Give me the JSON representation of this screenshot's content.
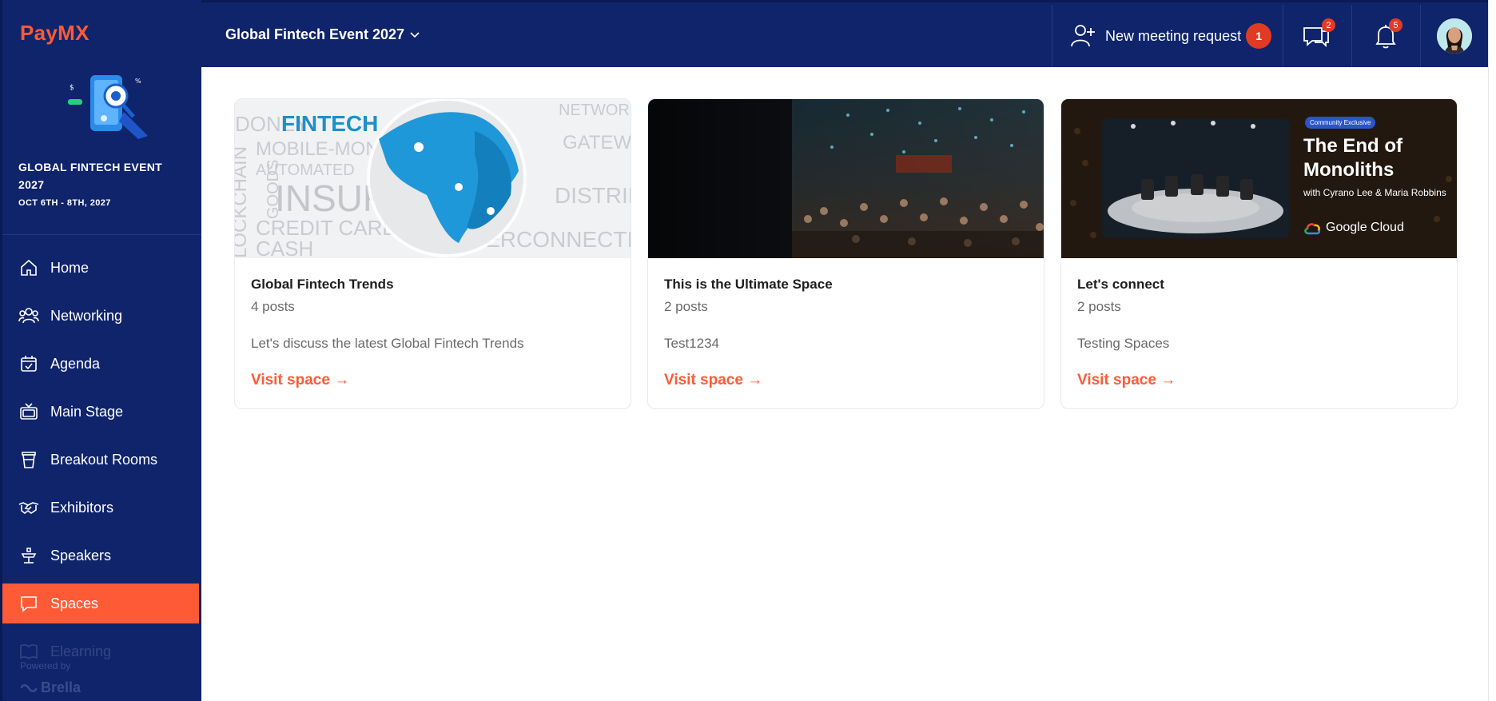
{
  "app": {
    "brand": "PayMX"
  },
  "sidebar": {
    "event_name": "GLOBAL FINTECH EVENT 2027",
    "event_dates": "OCT 6TH - 8TH, 2027",
    "items": [
      {
        "label": "Home",
        "icon": "home-icon",
        "active": false
      },
      {
        "label": "Networking",
        "icon": "people-icon",
        "active": false
      },
      {
        "label": "Agenda",
        "icon": "calendar-check-icon",
        "active": false
      },
      {
        "label": "Main Stage",
        "icon": "tv-icon",
        "active": false
      },
      {
        "label": "Breakout Rooms",
        "icon": "cup-icon",
        "active": false
      },
      {
        "label": "Exhibitors",
        "icon": "handshake-icon",
        "active": false
      },
      {
        "label": "Speakers",
        "icon": "podium-icon",
        "active": false
      },
      {
        "label": "Spaces",
        "icon": "chat-bubble-icon",
        "active": true
      },
      {
        "label": "Elearning",
        "icon": "book-icon",
        "active": false
      }
    ],
    "powered_by": "Powered by",
    "powered_logo": "Brella"
  },
  "topbar": {
    "event_selector": "Global Fintech Event 2027",
    "meeting_request_label": "New meeting request",
    "meeting_request_count": "1",
    "messages_count": "2",
    "notifications_count": "5"
  },
  "spaces": [
    {
      "title": "Global Fintech Trends",
      "posts": "4 posts",
      "description": "Let's discuss the latest Global Fintech Trends",
      "link": "Visit space →"
    },
    {
      "title": "This is the Ultimate Space",
      "posts": "2 posts",
      "description": "Test1234",
      "link": "Visit space →"
    },
    {
      "title": "Let's connect",
      "posts": "2 posts",
      "description": "Testing Spaces",
      "link": "Visit space →",
      "image_overlay": {
        "chip": "Community Exclusive",
        "title": "The End of Monoliths",
        "subtitle": "with Cyrano Lee & Maria Robbins",
        "brand": "Google Cloud"
      }
    }
  ],
  "card1_image_words": [
    "FINTECH",
    "MOBILE-MONEY",
    "AUTOMATED",
    "INSURA",
    "CREDIT CARDS",
    "CASH",
    "NETWORK",
    "GATEWAY",
    "DISTRIBUTE",
    "INTERCONNECTION",
    "LOCKCHAIN",
    "GOODS",
    "DONEY"
  ],
  "colors": {
    "navy": "#0f246b",
    "accent": "#ff5a36",
    "badge": "#e03b24"
  }
}
